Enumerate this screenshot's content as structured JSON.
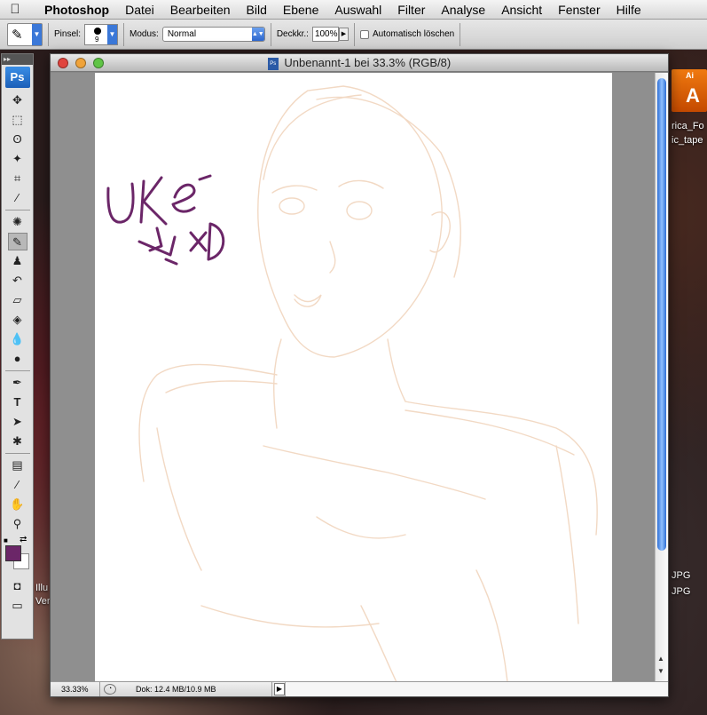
{
  "menubar": {
    "apple": "",
    "app_name": "Photoshop",
    "items": [
      "Datei",
      "Bearbeiten",
      "Bild",
      "Ebene",
      "Auswahl",
      "Filter",
      "Analyse",
      "Ansicht",
      "Fenster",
      "Hilfe"
    ]
  },
  "options": {
    "brush_label": "Pinsel:",
    "brush_size": "9",
    "mode_label": "Modus:",
    "mode_value": "Normal",
    "opacity_label": "Deckkr.:",
    "opacity_value": "100%",
    "auto_erase_label": "Automatisch löschen"
  },
  "toolbox": {
    "logo": "Ps",
    "foreground_color": "#6b2668",
    "background_color": "#ffffff"
  },
  "document": {
    "title": "Unbenannt-1 bei 33.3% (RGB/8)",
    "zoom": "33.33%",
    "doc_info": "Dok: 12.4 MB/10.9 MB",
    "sketch_text": "UKE~ xD",
    "sketch_color": "#f2d9c4",
    "ink_color": "#6b2668"
  },
  "desktop": {
    "file1_line1": "rica_Fo",
    "file1_line2": "ic_tape",
    "jpg1": "JPG",
    "jpg2": "JPG",
    "left_label1": "Illu",
    "left_label2": "Ver",
    "ai_icon": "Ai"
  }
}
